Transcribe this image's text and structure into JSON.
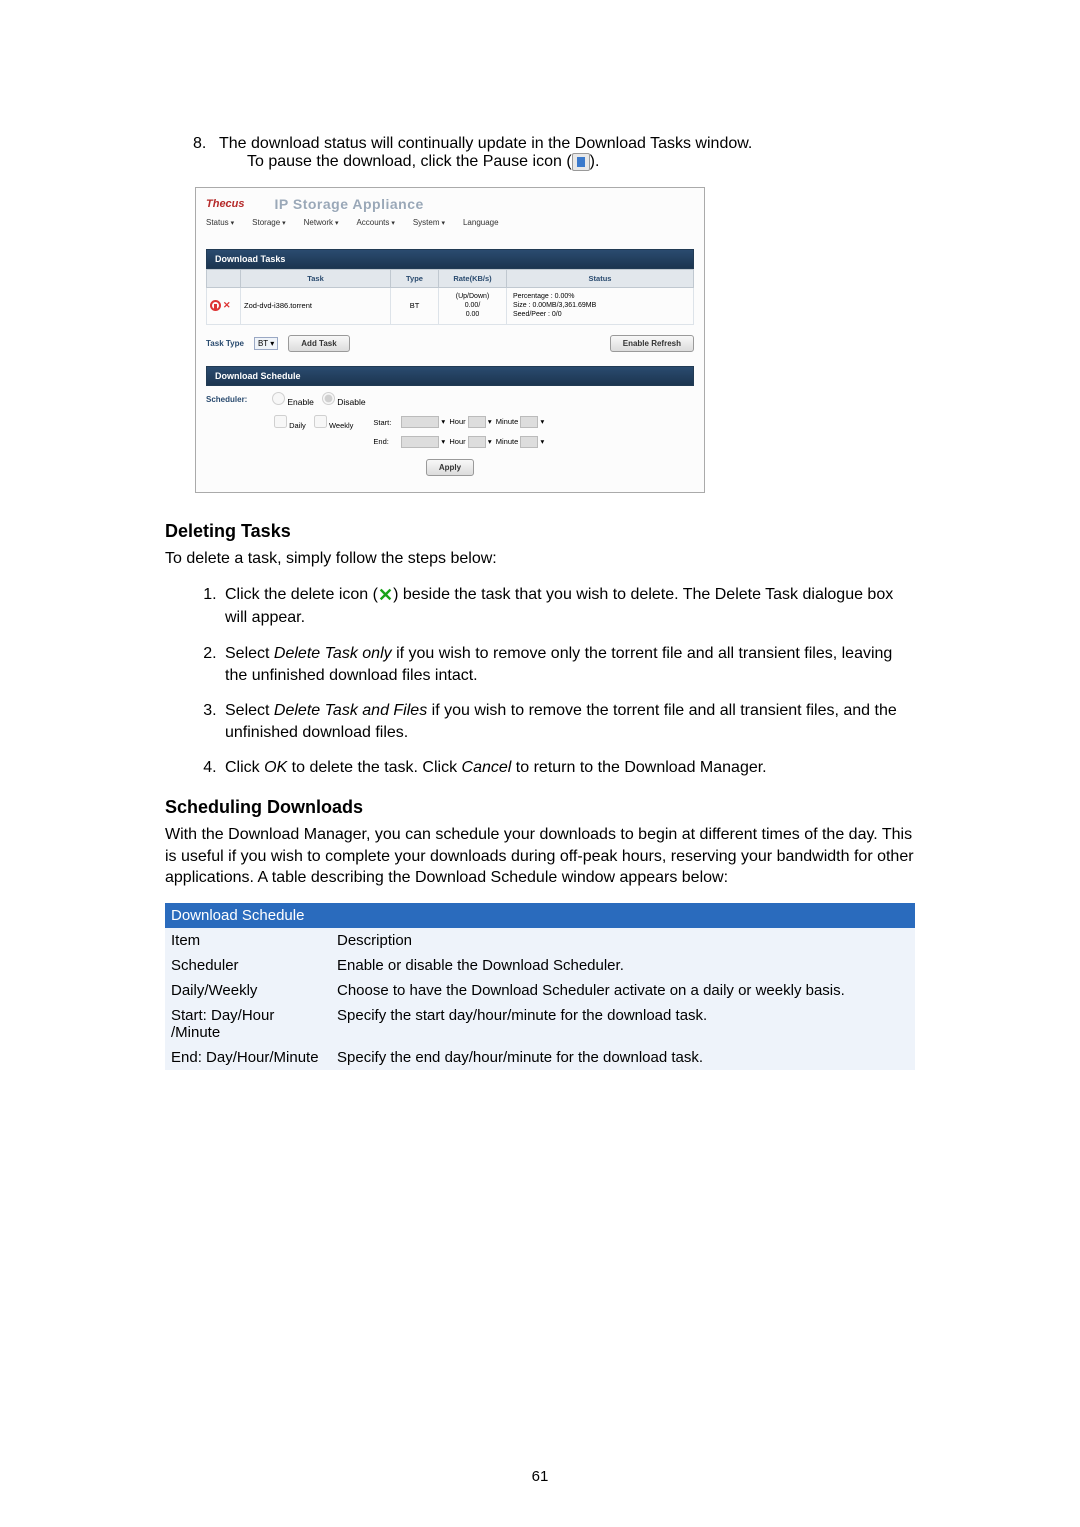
{
  "step8": {
    "num": "8.",
    "line1": "The download status will continually update in the Download Tasks window.",
    "line2_a": "To pause the download, click the Pause icon (",
    "line2_b": ")."
  },
  "shot": {
    "logo": "Thecus",
    "title": "IP Storage Appliance",
    "menu": [
      "Status",
      "Storage",
      "Network",
      "Accounts",
      "System",
      "Language"
    ],
    "tasks_bar": "Download Tasks",
    "th": [
      "Task",
      "Type",
      "Rate(KB/s)",
      "Status"
    ],
    "row": {
      "task": "Zod-dvd-i386.torrent",
      "type": "BT",
      "rate1": "(Up/Down)",
      "rate2": "0.00/",
      "rate3": "0.00",
      "st1": "Percentage : 0.00%",
      "st2": "Size : 0.00MB/3,361.69MB",
      "st3": "Seed/Peer : 0/0"
    },
    "task_type_lbl": "Task Type",
    "task_type_val": "BT",
    "add_btn": "Add Task",
    "refresh_btn": "Enable Refresh",
    "sched_bar": "Download Schedule",
    "sched_lbl": "Scheduler:",
    "enable": "Enable",
    "disable": "Disable",
    "daily": "Daily",
    "weekly": "Weekly",
    "start_lbl": "Start:",
    "end_lbl": "End:",
    "hour": "Hour",
    "minute": "Minute",
    "apply": "Apply"
  },
  "deleting": {
    "heading": "Deleting Tasks",
    "intro": "To delete a task, simply follow the steps below:",
    "s1a": "Click the delete icon (",
    "s1b": ") beside the task that you wish to delete. The Delete Task dialogue box will appear.",
    "s2": "Select Delete Task only if you wish to remove only the torrent file and all transient files, leaving the unfinished download files intact.",
    "s2_em": "Delete Task only",
    "s2_pre": "Select ",
    "s2_post": " if you wish to remove only the torrent file and all transient files, leaving the unfinished download files intact.",
    "s3_pre": "Select ",
    "s3_em": "Delete Task and Files",
    "s3_post": " if you wish to remove the torrent file and all transient files, and the unfinished download files.",
    "s4_pre": "Click ",
    "s4_em1": "OK",
    "s4_mid": " to delete the task. Click ",
    "s4_em2": "Cancel",
    "s4_post": " to return to the Download Manager."
  },
  "scheduling": {
    "heading": "Scheduling Downloads",
    "para": "With the Download Manager, you can schedule your downloads to begin at different times of the day. This is useful if you wish to complete your downloads during off-peak hours, reserving your bandwidth for other applications. A table describing the Download Schedule window appears below:"
  },
  "table": {
    "title": "Download Schedule",
    "hdr_item": "Item",
    "hdr_desc": "Description",
    "rows": [
      {
        "item": "Scheduler",
        "desc": "Enable or disable the Download Scheduler."
      },
      {
        "item": "Daily/Weekly",
        "desc": "Choose to have the Download Scheduler activate on a daily or weekly basis."
      },
      {
        "item": "Start: Day/Hour /Minute",
        "desc": "Specify the start day/hour/minute for the download task."
      },
      {
        "item": "End: Day/Hour/Minute",
        "desc": "Specify the end day/hour/minute for the download task."
      }
    ]
  },
  "pagenum": "61"
}
